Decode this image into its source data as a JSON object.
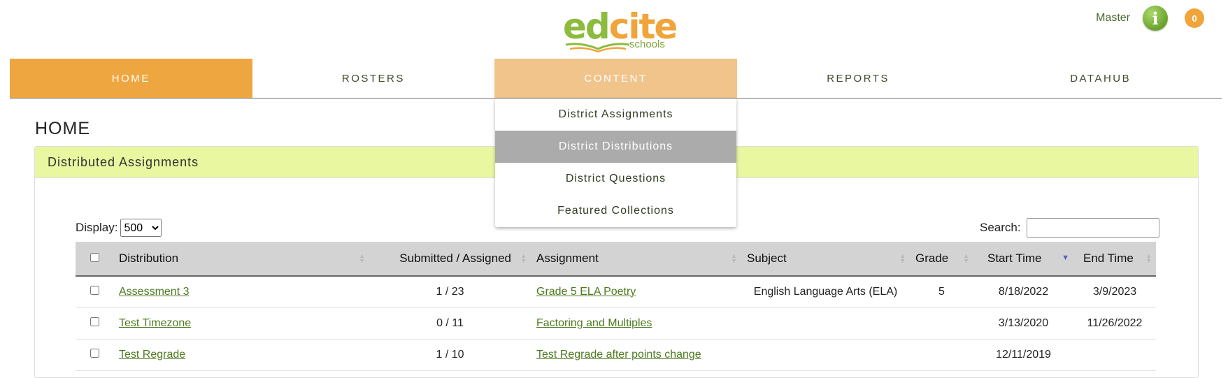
{
  "logo": {
    "part1": "ed",
    "part2": "cite",
    "subtext": "schools"
  },
  "user": {
    "name": "Master",
    "info_glyph": "i",
    "notification_count": "0"
  },
  "nav": {
    "items": [
      {
        "label": "HOME",
        "state": "active"
      },
      {
        "label": "ROSTERS",
        "state": "normal"
      },
      {
        "label": "CONTENT",
        "state": "hover"
      },
      {
        "label": "REPORTS",
        "state": "normal"
      },
      {
        "label": "DATAHUB",
        "state": "normal"
      }
    ]
  },
  "dropdown": {
    "items": [
      {
        "label": "District Assignments",
        "selected": false
      },
      {
        "label": "District Distributions",
        "selected": true
      },
      {
        "label": "District Questions",
        "selected": false
      },
      {
        "label": "Featured Collections",
        "selected": false
      }
    ]
  },
  "page": {
    "title": "HOME"
  },
  "panel": {
    "title": "Distributed Assignments"
  },
  "controls": {
    "display_label": "Display:",
    "display_value": "500",
    "search_label": "Search:",
    "search_value": ""
  },
  "table": {
    "headers": {
      "distribution": "Distribution",
      "submitted": "Submitted / Assigned",
      "assignment": "Assignment",
      "subject": "Subject",
      "grade": "Grade",
      "start": "Start Time",
      "end": "End Time"
    },
    "rows": [
      {
        "distribution": "Assessment 3",
        "submitted": "1 / 23",
        "assignment": "Grade 5 ELA Poetry",
        "subject": "English Language Arts (ELA)",
        "grade": "5",
        "start": "8/18/2022",
        "end": "3/9/2023"
      },
      {
        "distribution": "Test Timezone",
        "submitted": "0 / 11",
        "assignment": "Factoring and Multiples",
        "subject": "",
        "grade": "",
        "start": "3/13/2020",
        "end": "11/26/2022"
      },
      {
        "distribution": "Test Regrade",
        "submitted": "1 / 10",
        "assignment": "Test Regrade after points change",
        "subject": "",
        "grade": "",
        "start": "12/11/2019",
        "end": ""
      }
    ]
  },
  "colors": {
    "brand_orange": "#eea640",
    "brand_green": "#8dbb3d",
    "panel_header": "#e8f7a0",
    "link_green": "#4d7a1f"
  }
}
